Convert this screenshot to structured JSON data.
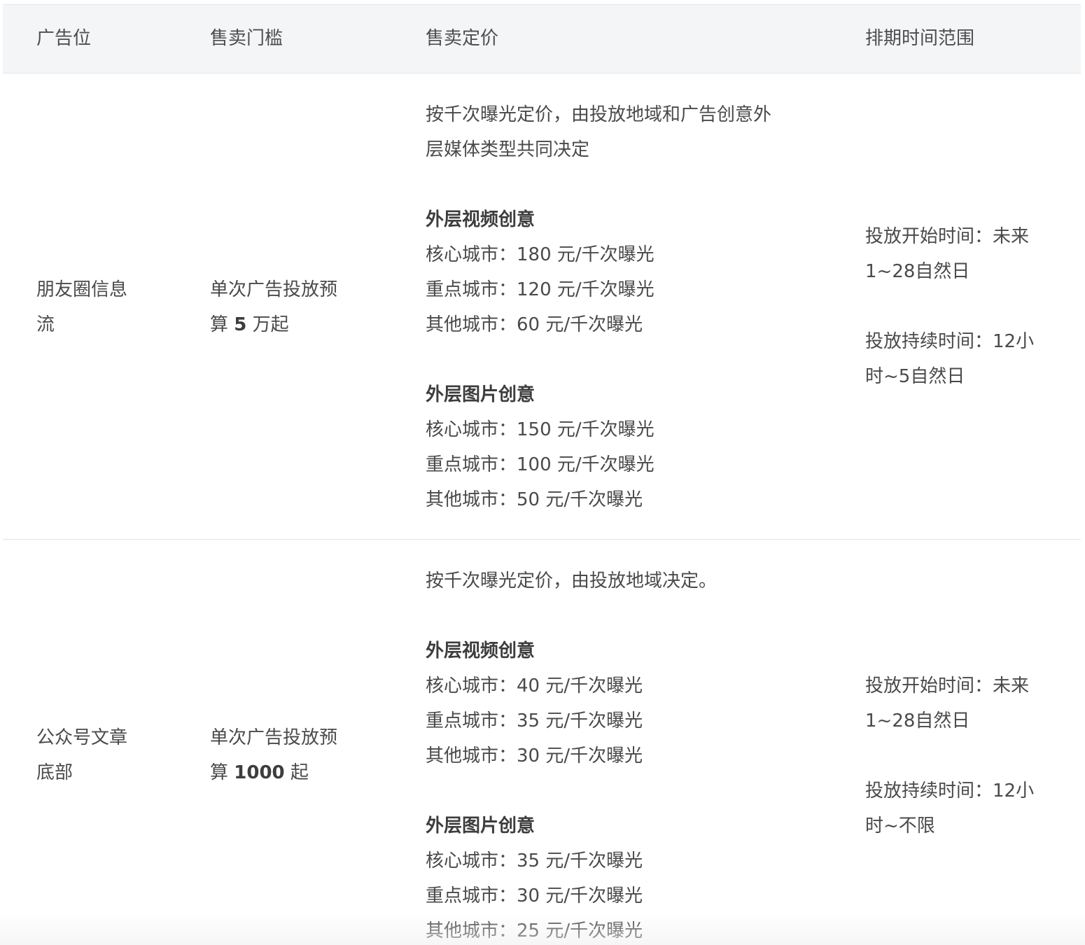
{
  "table": {
    "headers": [
      "广告位",
      "售卖门槛",
      "售卖定价",
      "排期时间范围"
    ],
    "rows": [
      {
        "slot": [
          "朋友圈信息",
          "流"
        ],
        "threshold": {
          "line1": "单次广告投放预",
          "prefix": "算 ",
          "amount": "5",
          "suffix": " 万起"
        },
        "pricing": {
          "intro": [
            "按千次曝光定价，由投放地域和广告创意外",
            "层媒体类型共同决定"
          ],
          "groups": [
            {
              "title": "外层视频创意",
              "lines": [
                "核心城市：180 元/千次曝光",
                "重点城市：120 元/千次曝光",
                "其他城市：60 元/千次曝光"
              ]
            },
            {
              "title": "外层图片创意",
              "lines": [
                "核心城市：150 元/千次曝光",
                "重点城市：100 元/千次曝光",
                "其他城市：50 元/千次曝光"
              ]
            }
          ]
        },
        "schedule": {
          "start": [
            "投放开始时间：未来",
            "1~28自然日"
          ],
          "duration": [
            "投放持续时间：12小",
            "时~5自然日"
          ]
        }
      },
      {
        "slot": [
          "公众号文章",
          "底部"
        ],
        "threshold": {
          "line1": "单次广告投放预",
          "prefix": "算 ",
          "amount": "1000",
          "suffix": " 起"
        },
        "pricing": {
          "intro": [
            "按千次曝光定价，由投放地域决定。"
          ],
          "groups": [
            {
              "title": "外层视频创意",
              "lines": [
                "核心城市：40 元/千次曝光",
                "重点城市：35 元/千次曝光",
                "其他城市：30 元/千次曝光"
              ]
            },
            {
              "title": "外层图片创意",
              "lines": [
                "核心城市：35 元/千次曝光",
                "重点城市：30 元/千次曝光",
                "其他城市：25 元/千次曝光"
              ]
            }
          ]
        },
        "schedule": {
          "start": [
            "投放开始时间：未来",
            "1~28自然日"
          ],
          "duration": [
            "投放持续时间：12小",
            "时~不限"
          ]
        }
      }
    ]
  }
}
